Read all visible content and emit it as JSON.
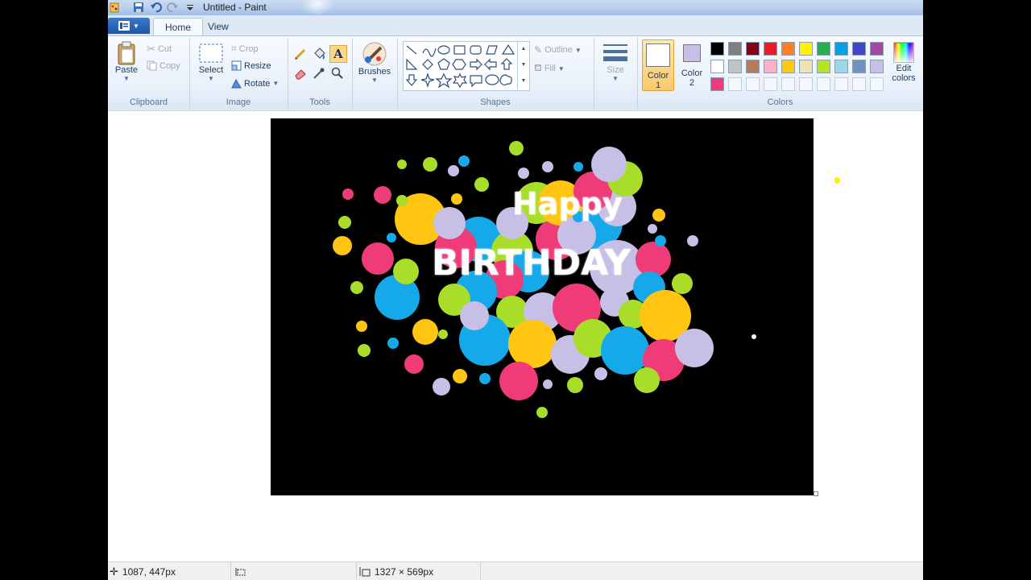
{
  "window": {
    "title": "Untitled - Paint"
  },
  "tabs": [
    {
      "label": "Home"
    },
    {
      "label": "View"
    }
  ],
  "clipboard": {
    "paste": "Paste",
    "cut": "Cut",
    "copy": "Copy",
    "group": "Clipboard"
  },
  "image_group": {
    "select": "Select",
    "crop": "Crop",
    "resize": "Resize",
    "rotate": "Rotate",
    "group": "Image"
  },
  "tools_group": {
    "group": "Tools"
  },
  "brushes": {
    "label": "Brushes"
  },
  "shapes_group": {
    "outline": "Outline",
    "fill": "Fill",
    "group": "Shapes"
  },
  "size": {
    "label": "Size"
  },
  "color1": {
    "label_line1": "Color",
    "label_line2": "1",
    "value": "#ffffff"
  },
  "color2": {
    "label_line1": "Color",
    "label_line2": "2",
    "value": "#c8bfe7"
  },
  "colors_group": {
    "group": "Colors",
    "edit_line1": "Edit",
    "edit_line2": "colors"
  },
  "palette_row1": [
    "#000000",
    "#7f7f7f",
    "#880015",
    "#ed1c24",
    "#ff7f27",
    "#fff200",
    "#22b14c",
    "#00a2e8",
    "#3f48cc",
    "#a349a4"
  ],
  "palette_row2": [
    "#ffffff",
    "#c3c3c3",
    "#b97a57",
    "#ffaec9",
    "#ffc90e",
    "#efe4b0",
    "#b5e61d",
    "#99d9ea",
    "#7092be",
    "#c8bfe7"
  ],
  "palette_row3": [
    "#ef3c78"
  ],
  "canvas": {
    "text_line1": "Happy",
    "text_line2": "BIRTHDAY"
  },
  "status": {
    "cursor_pos": "1087, 447px",
    "selection_size": "",
    "image_size": "1327 × 569px"
  }
}
